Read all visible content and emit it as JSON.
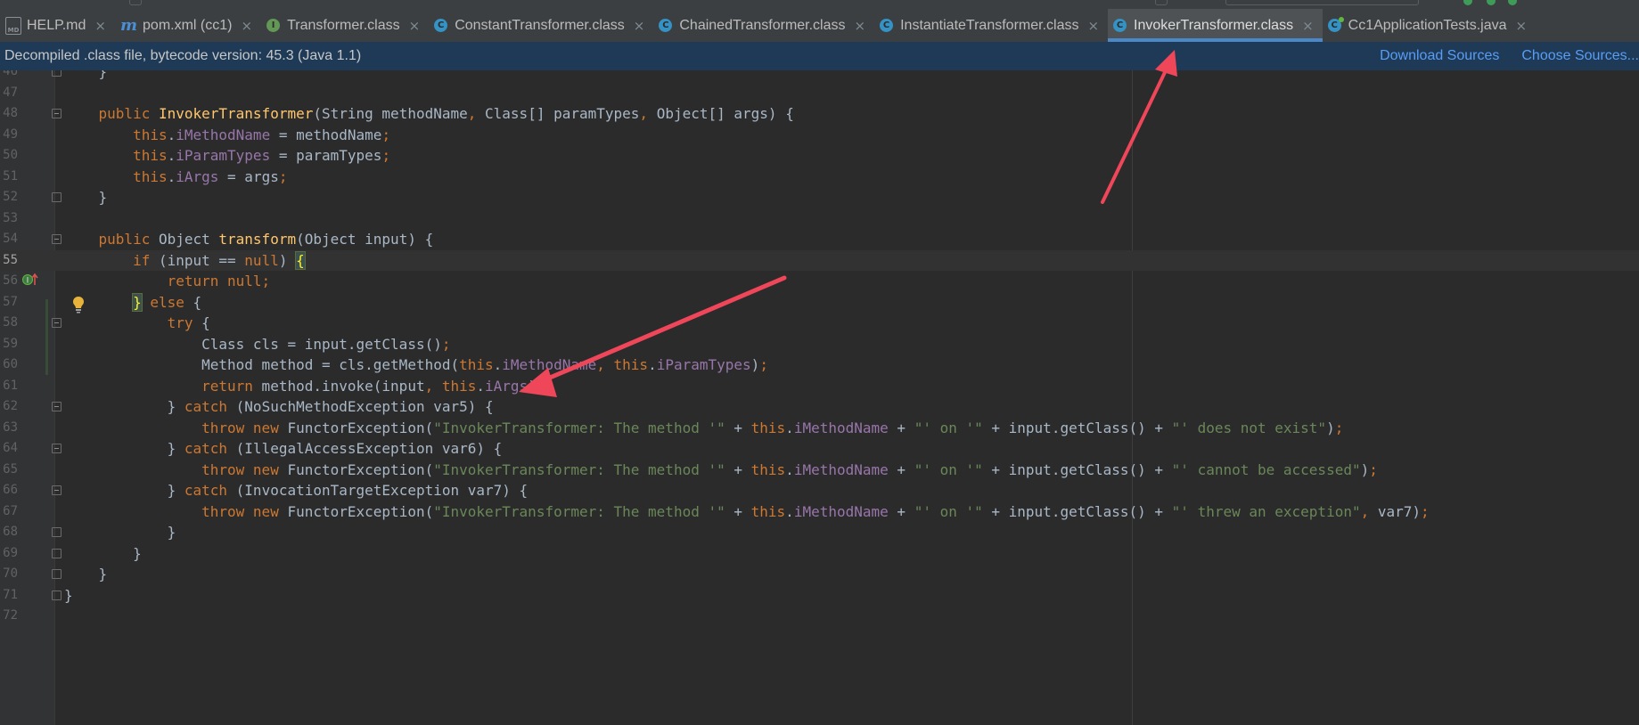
{
  "tabs": [
    {
      "label": "HELP.md",
      "icon": "markdown-file-icon",
      "active": false
    },
    {
      "label": "pom.xml (cc1)",
      "icon": "maven-icon",
      "active": false
    },
    {
      "label": "Transformer.class",
      "icon": "interface-class-icon",
      "active": false
    },
    {
      "label": "ConstantTransformer.class",
      "icon": "class-file-icon",
      "active": false
    },
    {
      "label": "ChainedTransformer.class",
      "icon": "class-file-icon",
      "active": false
    },
    {
      "label": "InstantiateTransformer.class",
      "icon": "class-file-icon",
      "active": false
    },
    {
      "label": "InvokerTransformer.class",
      "icon": "class-file-icon",
      "active": true
    },
    {
      "label": "Cc1ApplicationTests.java",
      "icon": "java-test-class-icon",
      "active": false
    }
  ],
  "tab_close_glyph": "×",
  "infobar": {
    "message": "Decompiled .class file, bytecode version: 45.3 (Java 1.1)",
    "download_sources": "Download Sources",
    "choose_sources": "Choose Sources..."
  },
  "editor": {
    "current_line": "55",
    "lines": [
      {
        "n": "46",
        "fold": "end",
        "html": "    }"
      },
      {
        "n": "47",
        "fold": "",
        "html": ""
      },
      {
        "n": "48",
        "fold": "open",
        "html": "    <span class=\"k\">public</span> <span class=\"m\">InvokerTransformer</span>(String methodName<span class=\"k\">,</span> Class[] paramTypes<span class=\"k\">,</span> Object[] args) {"
      },
      {
        "n": "49",
        "fold": "",
        "html": "        <span class=\"k\">this</span>.<span class=\"f\">iMethodName</span> = methodName<span class=\"k\">;</span>"
      },
      {
        "n": "50",
        "fold": "",
        "html": "        <span class=\"k\">this</span>.<span class=\"f\">iParamTypes</span> = paramTypes<span class=\"k\">;</span>"
      },
      {
        "n": "51",
        "fold": "",
        "html": "        <span class=\"k\">this</span>.<span class=\"f\">iArgs</span> = args<span class=\"k\">;</span>"
      },
      {
        "n": "52",
        "fold": "end",
        "html": "    }"
      },
      {
        "n": "53",
        "fold": "",
        "html": ""
      },
      {
        "n": "54",
        "fold": "open",
        "html": "    <span class=\"k\">public</span> Object <span class=\"m\">transform</span>(Object input) {"
      },
      {
        "n": "55",
        "fold": "",
        "html": "        <span class=\"k\">if</span> (input == <span class=\"k\">null</span>) <span class=\"brace-hl\">{</span>"
      },
      {
        "n": "56",
        "fold": "",
        "html": "            <span class=\"k\">return null;</span>"
      },
      {
        "n": "57",
        "fold": "",
        "html": "        <span class=\"brace-hl\">}</span> <span class=\"k\">else</span> {"
      },
      {
        "n": "58",
        "fold": "open",
        "html": "            <span class=\"k\">try</span> {"
      },
      {
        "n": "59",
        "fold": "",
        "html": "                Class cls = input.getClass()<span class=\"k\">;</span>"
      },
      {
        "n": "60",
        "fold": "",
        "html": "                Method method = cls.getMethod(<span class=\"k\">this</span>.<span class=\"f\">iMethodName</span><span class=\"k\">,</span> <span class=\"k\">this</span>.<span class=\"f\">iParamTypes</span>)<span class=\"k\">;</span>"
      },
      {
        "n": "61",
        "fold": "",
        "html": "                <span class=\"k\">return</span> method.invoke(input<span class=\"k\">,</span> <span class=\"k\">this</span>.<span class=\"f\">iArgs</span>)<span class=\"k\">;</span>"
      },
      {
        "n": "62",
        "fold": "open",
        "html": "            } <span class=\"k\">catch</span> (NoSuchMethodException var5) {"
      },
      {
        "n": "63",
        "fold": "",
        "html": "                <span class=\"k\">throw new</span> FunctorException(<span class=\"s\">\"InvokerTransformer: The method '\"</span> + <span class=\"k\">this</span>.<span class=\"f\">iMethodName</span> + <span class=\"s\">\"' on '\"</span> + input.getClass() + <span class=\"s\">\"' does not exist\"</span>)<span class=\"k\">;</span>"
      },
      {
        "n": "64",
        "fold": "open",
        "html": "            } <span class=\"k\">catch</span> (IllegalAccessException var6) {"
      },
      {
        "n": "65",
        "fold": "",
        "html": "                <span class=\"k\">throw new</span> FunctorException(<span class=\"s\">\"InvokerTransformer: The method '\"</span> + <span class=\"k\">this</span>.<span class=\"f\">iMethodName</span> + <span class=\"s\">\"' on '\"</span> + input.getClass() + <span class=\"s\">\"' cannot be accessed\"</span>)<span class=\"k\">;</span>"
      },
      {
        "n": "66",
        "fold": "open",
        "html": "            } <span class=\"k\">catch</span> (InvocationTargetException var7) {"
      },
      {
        "n": "67",
        "fold": "",
        "html": "                <span class=\"k\">throw new</span> FunctorException(<span class=\"s\">\"InvokerTransformer: The method '\"</span> + <span class=\"k\">this</span>.<span class=\"f\">iMethodName</span> + <span class=\"s\">\"' on '\"</span> + input.getClass() + <span class=\"s\">\"' threw an exception\"</span><span class=\"k\">,</span> var7)<span class=\"k\">;</span>"
      },
      {
        "n": "68",
        "fold": "end",
        "html": "            }"
      },
      {
        "n": "69",
        "fold": "end",
        "html": "        }"
      },
      {
        "n": "70",
        "fold": "end",
        "html": "    }"
      },
      {
        "n": "71",
        "fold": "end",
        "html": "}"
      },
      {
        "n": "72",
        "fold": "",
        "html": ""
      }
    ]
  },
  "colors": {
    "keyword": "#cc7832",
    "field": "#9876aa",
    "method": "#ffc66d",
    "string": "#6a8759",
    "annotation_arrow": "#f0465a"
  }
}
